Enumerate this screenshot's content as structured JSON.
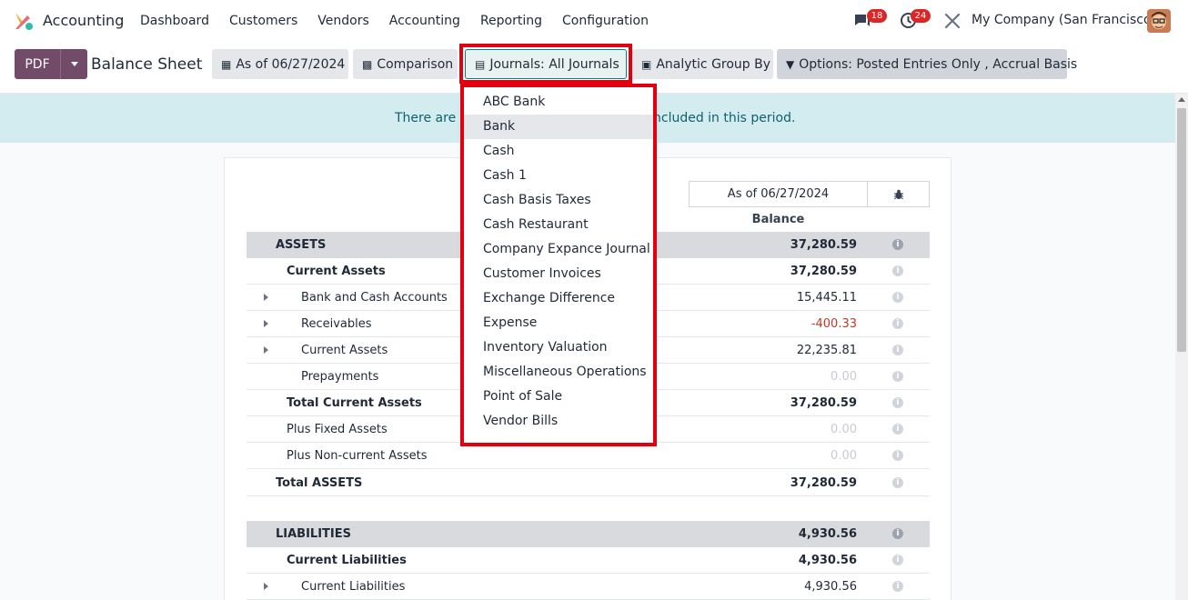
{
  "nav": {
    "app_name": "Accounting",
    "menu": [
      "Dashboard",
      "Customers",
      "Vendors",
      "Accounting",
      "Reporting",
      "Configuration"
    ],
    "messages_count": "18",
    "activities_count": "24",
    "company": "My Company (San Francisco)"
  },
  "controls": {
    "pdf_label": "PDF",
    "page_title": "Balance Sheet",
    "date_filter": "As of 06/27/2024",
    "comparison": "Comparison",
    "journals": "Journals: All Journals",
    "analytic": "Analytic Group By",
    "options": "Options: Posted Entries Only , Accrual Basis"
  },
  "banner": {
    "text_left": "There are u",
    "text_right": "ncluded in this period."
  },
  "report": {
    "column_date": "As of 06/27/2024",
    "column_balance": "Balance",
    "rows": [
      {
        "label": "ASSETS",
        "value": "37,280.59"
      },
      {
        "label": "Current Assets",
        "value": "37,280.59"
      },
      {
        "label": "Bank and Cash Accounts",
        "value": "15,445.11"
      },
      {
        "label": "Receivables",
        "value": "-400.33"
      },
      {
        "label": "Current Assets",
        "value": "22,235.81"
      },
      {
        "label": "Prepayments",
        "value": "0.00"
      },
      {
        "label": "Total Current Assets",
        "value": "37,280.59"
      },
      {
        "label": "Plus Fixed Assets",
        "value": "0.00"
      },
      {
        "label": "Plus Non-current Assets",
        "value": "0.00"
      },
      {
        "label": "Total ASSETS",
        "value": "37,280.59"
      },
      {
        "label": "LIABILITIES",
        "value": "4,930.56"
      },
      {
        "label": "Current Liabilities",
        "value": "4,930.56"
      },
      {
        "label": "Current Liabilities",
        "value": "4,930.56"
      }
    ]
  },
  "journals_dropdown": [
    "ABC Bank",
    "Bank",
    "Cash",
    "Cash 1",
    "Cash Basis Taxes",
    "Cash Restaurant",
    "Company Expance Journal",
    "Customer Invoices",
    "Exchange Difference",
    "Expense",
    "Inventory Valuation",
    "Miscellaneous Operations",
    "Point of Sale",
    "Vendor Bills"
  ],
  "colors": {
    "brand": "#714b67",
    "highlight": "#e00010",
    "banner_bg": "#d2ecf0",
    "negative": "#c0392b"
  }
}
